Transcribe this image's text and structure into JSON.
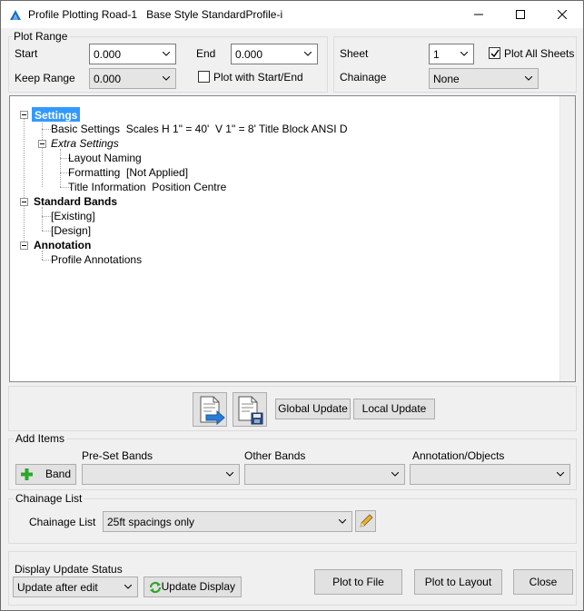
{
  "window": {
    "title": "Profile Plotting Road-1   Base Style StandardProfile-i"
  },
  "plot_range": {
    "label": "Plot Range",
    "start_label": "Start",
    "start_value": "0.000",
    "end_label": "End",
    "end_value": "0.000",
    "keep_range_label": "Keep Range",
    "keep_range_value": "0.000",
    "plot_start_end_label": "Plot with Start/End",
    "plot_start_end_checked": false
  },
  "sheet": {
    "sheet_label": "Sheet",
    "sheet_value": "1",
    "plot_all_label": "Plot All Sheets",
    "plot_all_checked": true,
    "chainage_label": "Chainage",
    "chainage_value": "None"
  },
  "tree": {
    "settings": "Settings",
    "basic_settings": "Basic Settings  Scales H 1\" = 40'  V 1\" = 8' Title Block ANSI D",
    "extra_settings": "Extra Settings",
    "layout_naming": "Layout Naming",
    "formatting": "Formatting  [Not Applied]",
    "title_information": "Title Information  Position Centre",
    "standard_bands": "Standard Bands",
    "existing": "[Existing]",
    "design": "[Design]",
    "annotation": "Annotation",
    "profile_annotations": "Profile Annotations"
  },
  "actions": {
    "global_update": "Global Update",
    "local_update": "Local Update"
  },
  "add_items": {
    "label": "Add Items",
    "band_button": "Band",
    "preset_bands_label": "Pre-Set Bands",
    "other_bands_label": "Other Bands",
    "annotation_objects_label": "Annotation/Objects"
  },
  "chainage_list": {
    "label": "Chainage List",
    "field_label": "Chainage List",
    "value": "25ft spacings only"
  },
  "display": {
    "label": "Display Update Status",
    "mode_value": "Update after edit",
    "update_display": "Update Display"
  },
  "footer": {
    "plot_to_file": "Plot to File",
    "plot_to_layout": "Plot to Layout",
    "close": "Close"
  }
}
